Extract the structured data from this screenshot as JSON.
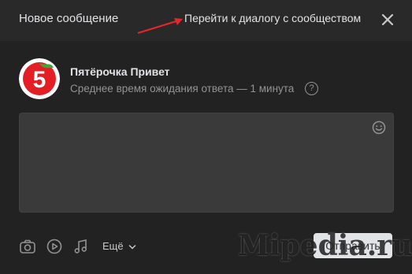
{
  "header": {
    "title": "Новое сообщение",
    "goto_dialog_link": "Перейти к диалогу с сообществом"
  },
  "community": {
    "name": "Пятёрочка Привет",
    "wait_text": "Среднее время ожидания ответа — 1 минута",
    "help_glyph": "?",
    "logo_digit": "5"
  },
  "message": {
    "value": "",
    "placeholder": ""
  },
  "toolbar": {
    "more_label": "Ещё",
    "send_label": "Отправить"
  },
  "watermark": "Mipedia.ru",
  "colors": {
    "background": "#222222",
    "header": "#292929",
    "input": "#3a3a3a",
    "arrow": "#e8262b",
    "logo_red": "#e31e24",
    "logo_green": "#3aa935"
  },
  "icons": [
    "close-icon",
    "emoji-icon",
    "camera-icon",
    "video-icon",
    "music-icon",
    "chevron-down-icon",
    "help-icon"
  ]
}
